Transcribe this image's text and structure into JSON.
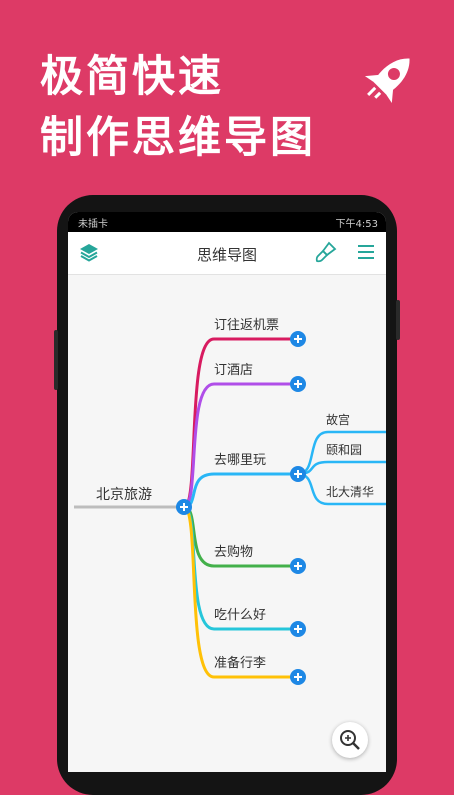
{
  "promo": {
    "line1": "极简快速",
    "line2": "制作思维导图"
  },
  "status_bar": {
    "left": "未插卡",
    "right": "下午4:53"
  },
  "app_bar": {
    "title": "思维导图",
    "left_icon": "layers-icon",
    "right_icons": [
      "brush-icon",
      "menu-icon"
    ]
  },
  "mindmap": {
    "root": "北京旅游",
    "branches": [
      {
        "label": "订往返机票",
        "color": "#d81b60"
      },
      {
        "label": "订酒店",
        "color": "#b04ee8"
      },
      {
        "label": "去哪里玩",
        "color": "#29b6f6",
        "children": [
          "故宫",
          "颐和园",
          "北大清华"
        ]
      },
      {
        "label": "去购物",
        "color": "#43b04a"
      },
      {
        "label": "吃什么好",
        "color": "#26c6da"
      },
      {
        "label": "准备行李",
        "color": "#ffc107"
      }
    ]
  },
  "fab_icon": "zoom-reset-icon",
  "colors": {
    "background": "#dd3a66",
    "node_button": "#1e88e5",
    "root_line": "#bdbdbd"
  }
}
